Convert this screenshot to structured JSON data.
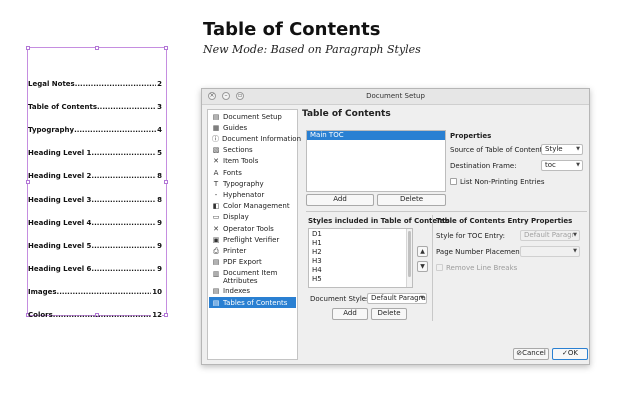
{
  "heading": {
    "title": "Table of Contents",
    "subtitle": "New Mode: Based on Paragraph Styles"
  },
  "toc": {
    "entries": [
      {
        "label": "Legal Notes",
        "page": "2"
      },
      {
        "label": "Table of Contents",
        "page": "3"
      },
      {
        "label": "Typography",
        "page": "4"
      },
      {
        "label": "Heading Level 1",
        "page": "5"
      },
      {
        "label": "Heading Level 2",
        "page": "8"
      },
      {
        "label": "Heading Level 3",
        "page": "8"
      },
      {
        "label": "Heading Level 4",
        "page": "9"
      },
      {
        "label": "Heading Level 5",
        "page": "9"
      },
      {
        "label": "Heading Level 6",
        "page": "9"
      },
      {
        "label": "Images",
        "page": "10"
      },
      {
        "label": "Colors",
        "page": "12"
      }
    ]
  },
  "dialog": {
    "title": "Document Setup",
    "titlebar_buttons": [
      "close",
      "minimize",
      "maximize"
    ],
    "sidebar": [
      {
        "label": "Document Setup",
        "icon": "document-icon"
      },
      {
        "label": "Guides",
        "icon": "guides-icon"
      },
      {
        "label": "Document Information",
        "icon": "info-icon"
      },
      {
        "label": "Sections",
        "icon": "sections-icon"
      },
      {
        "label": "Item Tools",
        "icon": "tools-icon"
      },
      {
        "label": "Fonts",
        "icon": "fonts-icon"
      },
      {
        "label": "Typography",
        "icon": "typography-icon"
      },
      {
        "label": "Hyphenator",
        "icon": "hyphenator-icon"
      },
      {
        "label": "Color Management",
        "icon": "color-icon"
      },
      {
        "label": "Display",
        "icon": "display-icon"
      },
      {
        "label": "Operator Tools",
        "icon": "operator-icon"
      },
      {
        "label": "Preflight Verifier",
        "icon": "preflight-icon"
      },
      {
        "label": "Printer",
        "icon": "printer-icon"
      },
      {
        "label": "PDF Export",
        "icon": "pdf-icon"
      },
      {
        "label": "Document Item Attributes",
        "icon": "attributes-icon"
      },
      {
        "label": "Indexes",
        "icon": "indexes-icon"
      },
      {
        "label": "Tables of Contents",
        "icon": "toc-icon",
        "active": true
      }
    ],
    "content_title": "Table of Contents",
    "toc_list": {
      "items": [
        "Main TOC"
      ],
      "selected": "Main TOC",
      "add_label": "Add",
      "delete_label": "Delete"
    },
    "properties": {
      "title": "Properties",
      "source_label": "Source of Table of Contents:",
      "source_value": "Style",
      "destination_label": "Destination Frame:",
      "destination_value": "toc",
      "non_printing_label": "List Non-Printing Entries"
    },
    "styles_section": {
      "title": "Styles included in Table of Contents",
      "items": [
        "D1",
        "H1",
        "H2",
        "H3",
        "H4",
        "H5"
      ],
      "up_label": "^",
      "down_label": "v",
      "doc_styles_label": "Document Styles:",
      "doc_styles_value": "Default Paragra",
      "add_label": "Add",
      "delete_label": "Delete"
    },
    "entry_properties": {
      "title": "Table of Contents Entry Properties",
      "style_label": "Style for TOC Entry:",
      "style_value": "Default Paragr",
      "page_number_label": "Page Number Placement:",
      "page_number_value": "",
      "remove_breaks_label": "Remove Line Breaks"
    },
    "footer": {
      "cancel_label": "Cancel",
      "ok_label": "OK"
    }
  }
}
